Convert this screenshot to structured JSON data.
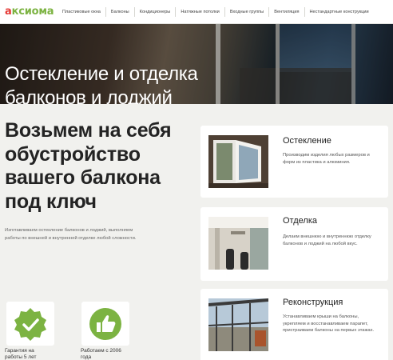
{
  "brand": {
    "logo_first": "а",
    "logo_rest": "кcиома",
    "logo_color": "#7cb342",
    "logo_accent": "#e53935"
  },
  "nav": {
    "items": [
      "Пластиковые окна",
      "Балконы",
      "Кондиционеры",
      "Натяжные потолки",
      "Входные группы",
      "Вентиляция",
      "Нестандартные конструкции"
    ]
  },
  "hero": {
    "title": "Остекление и отделка балконов и лоджий"
  },
  "intro": {
    "title": "Возьмем на себя обустройство вашего балкона под ключ",
    "description": "Изготавливаем остекление балконов и лоджий, выполняем работы по внешней и внутренней отделке любой сложности."
  },
  "badges": [
    {
      "icon": "check-badge-icon",
      "label": "Гарантия на работы 5 лет"
    },
    {
      "icon": "thumbs-up-icon",
      "label": "Работаем с 2006 года"
    }
  ],
  "services": [
    {
      "title": "Остекление",
      "text": "Производим изделия любых размеров и форм из пластика и алюминия."
    },
    {
      "title": "Отделка",
      "text": "Делаем внешнюю и внутреннюю отделку балконов и лоджий на любой вкус."
    },
    {
      "title": "Реконструкция",
      "text": "Устанавливаем крыши на балконы, укрепляем и восстанавливаем парапет, пристраиваем балконы на первых этажах."
    }
  ],
  "colors": {
    "accent": "#7cb342",
    "background": "#f1f1ee",
    "card": "#ffffff"
  }
}
